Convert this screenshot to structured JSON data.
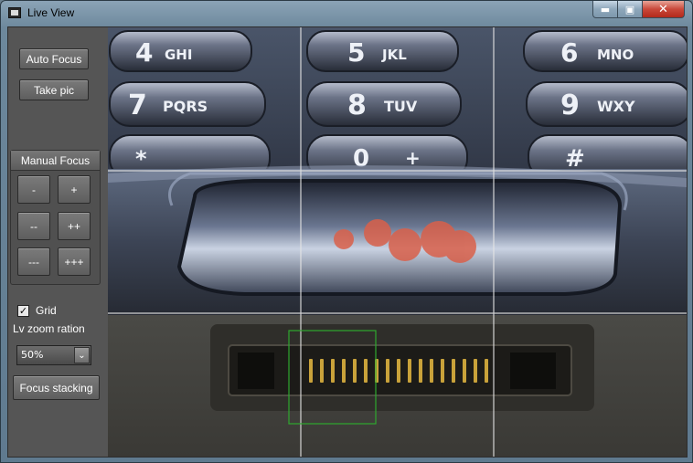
{
  "window": {
    "title": "Live View",
    "icon": "camera-app-icon",
    "controls": {
      "minimize": "▬",
      "maximize": "▣",
      "close": "✕"
    }
  },
  "sidebar": {
    "auto_focus_label": "Auto Focus",
    "take_pic_label": "Take pic",
    "manual_focus": {
      "title": "Manual Focus",
      "buttons": [
        {
          "left": "-",
          "right": "+"
        },
        {
          "left": "--",
          "right": "++"
        },
        {
          "left": "---",
          "right": "+++"
        }
      ]
    },
    "grid": {
      "label": "Grid",
      "checked": true,
      "check_mark": "✓"
    },
    "zoom": {
      "label": "Lv zoom ration",
      "selected": "50%",
      "arrow": "⌄"
    },
    "focus_stacking_label": "Focus stacking"
  },
  "live_view": {
    "grid_lines": "rule-of-thirds",
    "keypad_keys": [
      {
        "key": "4",
        "letters": "GHI"
      },
      {
        "key": "5",
        "letters": "JKL"
      },
      {
        "key": "6",
        "letters": "MNO"
      },
      {
        "key": "7",
        "letters": "PQRS"
      },
      {
        "key": "8",
        "letters": "TUV"
      },
      {
        "key": "9",
        "letters": "WXY"
      },
      {
        "key": "*",
        "letters": ""
      },
      {
        "key": "0",
        "letters": "+"
      },
      {
        "key": "#",
        "letters": ""
      }
    ],
    "focus_box_color": "#2fa82f"
  }
}
